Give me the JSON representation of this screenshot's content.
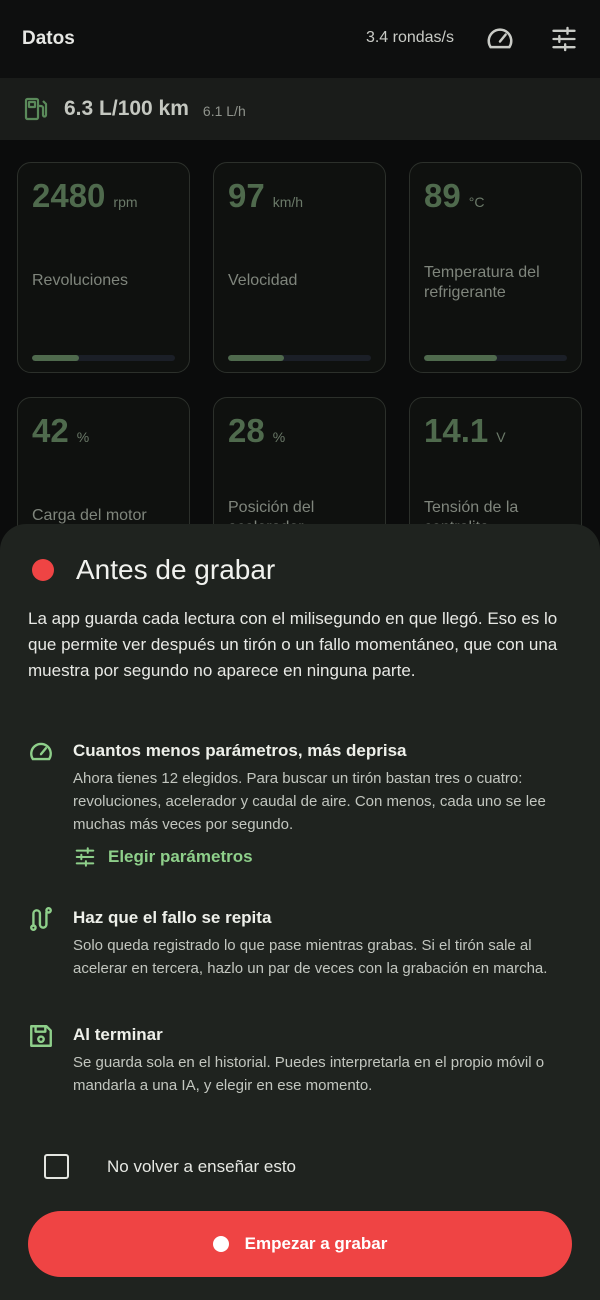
{
  "topbar": {
    "title": "Datos",
    "rate": "3.4 rondas/s",
    "gauge_icon": "speed-gauge-icon",
    "settings_icon": "tune-icon"
  },
  "fuel": {
    "icon": "fuel-pump-icon",
    "main": "6.3 L/100 km",
    "sub": "6.1 L/h"
  },
  "gauges": [
    {
      "value": "2480",
      "unit": "rpm",
      "label": "Revoluciones",
      "level": 0.33
    },
    {
      "value": "97",
      "unit": "km/h",
      "label": "Velocidad",
      "level": 0.39
    },
    {
      "value": "89",
      "unit": "°C",
      "label": "Temperatura del refrigerante",
      "level": 0.51
    },
    {
      "value": "42",
      "unit": "%",
      "label": "Carga del motor"
    },
    {
      "value": "28",
      "unit": "%",
      "label": "Posición del acelerador"
    },
    {
      "value": "14.1",
      "unit": "V",
      "label": "Tensión de la centralita"
    }
  ],
  "sheet": {
    "title": "Antes de grabar",
    "intro": "La app guarda cada lectura con el milisegundo en que llegó. Eso es lo que permite ver después un tirón o un fallo momentáneo, que con una muestra por segundo no aparece en ninguna parte.",
    "tips": [
      {
        "icon": "speed-gauge-icon",
        "title": "Cuantos menos parámetros, más deprisa",
        "body": "Ahora tienes 12 elegidos. Para buscar un tirón bastan tres o cuatro: revoluciones, acelerador y caudal de aire. Con menos, cada uno se lee muchas más veces por segundo."
      },
      {
        "icon": "route-icon",
        "title": "Haz que el fallo se repita",
        "body": "Solo queda registrado lo que pase mientras grabas. Si el tirón sale al acelerar en tercera, hazlo un par de veces con la grabación en marcha."
      },
      {
        "icon": "save-icon",
        "title": "Al terminar",
        "body": "Se guarda sola en el historial. Puedes interpretarla en el propio móvil o mandarla a una IA, y elegir en ese momento."
      }
    ],
    "choose_link": "Elegir parámetros",
    "dont_show": "No volver a enseñar esto",
    "dont_show_checked": false,
    "start_button": "Empezar a grabar",
    "colors": {
      "accent": "#8ecf8a",
      "record": "#ef4444",
      "sheet_bg": "#1f231f"
    }
  }
}
